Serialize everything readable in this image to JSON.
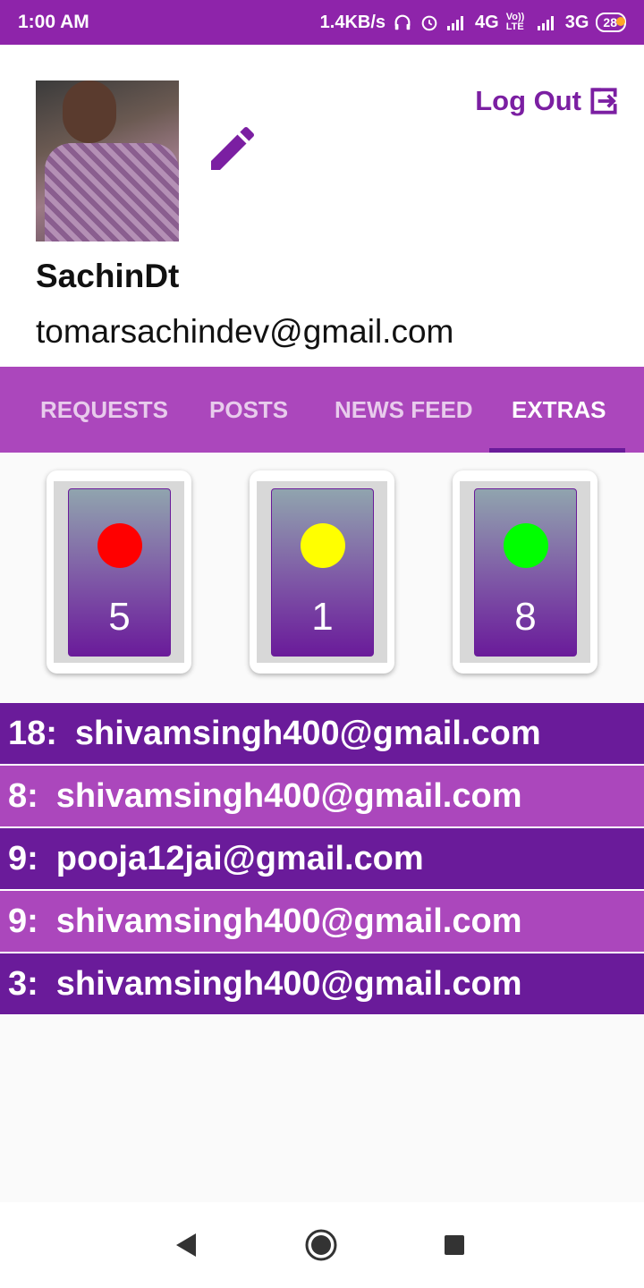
{
  "status_bar": {
    "time": "1:00 AM",
    "speed": "1.4KB/s",
    "network1": "4G",
    "volte": "Vo)) LTE",
    "network2": "3G",
    "battery": "28",
    "icons": [
      "headphones-icon",
      "alarm-icon",
      "signal-icon",
      "signal-icon"
    ]
  },
  "profile": {
    "username": "SachinDt",
    "email": "tomarsachindev@gmail.com",
    "logout_label": "Log Out",
    "edit_icon": "pencil-icon",
    "logout_icon": "logout-icon"
  },
  "tabs": [
    {
      "label": "REQUESTS",
      "active": false
    },
    {
      "label": "POSTS",
      "active": false
    },
    {
      "label": "NEWS FEED",
      "active": false
    },
    {
      "label": "EXTRAS",
      "active": true
    }
  ],
  "stat_cards": [
    {
      "color": "#ff0000",
      "count": "5"
    },
    {
      "color": "#ffff00",
      "count": "1"
    },
    {
      "color": "#00ff00",
      "count": "8"
    }
  ],
  "entries": [
    {
      "index": "18:",
      "email": "shivamsingh400@gmail.com"
    },
    {
      "index": "8:",
      "email": "shivamsingh400@gmail.com"
    },
    {
      "index": "9:",
      "email": "pooja12jai@gmail.com"
    },
    {
      "index": "9:",
      "email": "shivamsingh400@gmail.com"
    },
    {
      "index": "3:",
      "email": "shivamsingh400@gmail.com"
    }
  ],
  "colors": {
    "primary": "#8e24aa",
    "tab_bar": "#ab47bc",
    "dark_row": "#6a1b9a",
    "light_row": "#ab47bc"
  },
  "nav": [
    "back-icon",
    "home-icon",
    "recents-icon"
  ]
}
